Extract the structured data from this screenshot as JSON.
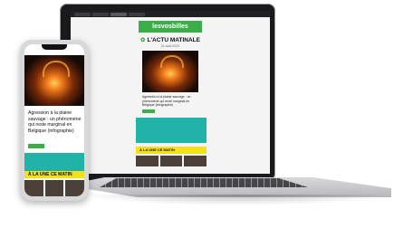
{
  "laptop": {
    "site_logo": "lesvosbilles",
    "section_title": "L'ACTU MATINALE",
    "date": "21 août 2022",
    "headline": "Agression à la plaine sauvage : un phénomène qui reste marginal en Belgique (infographie)",
    "strip_label": "À LA UNE CE MATIN"
  },
  "phone": {
    "headline": "Agression à la plaine sauvage : un phénomène qui reste marginal en Belgique (infographie)",
    "strip_label": "À LA UNE CE MATIN"
  },
  "colors": {
    "accent_green": "#3aae49",
    "teal_block": "#22b3a8",
    "yellow_strip": "#f5e11a"
  }
}
